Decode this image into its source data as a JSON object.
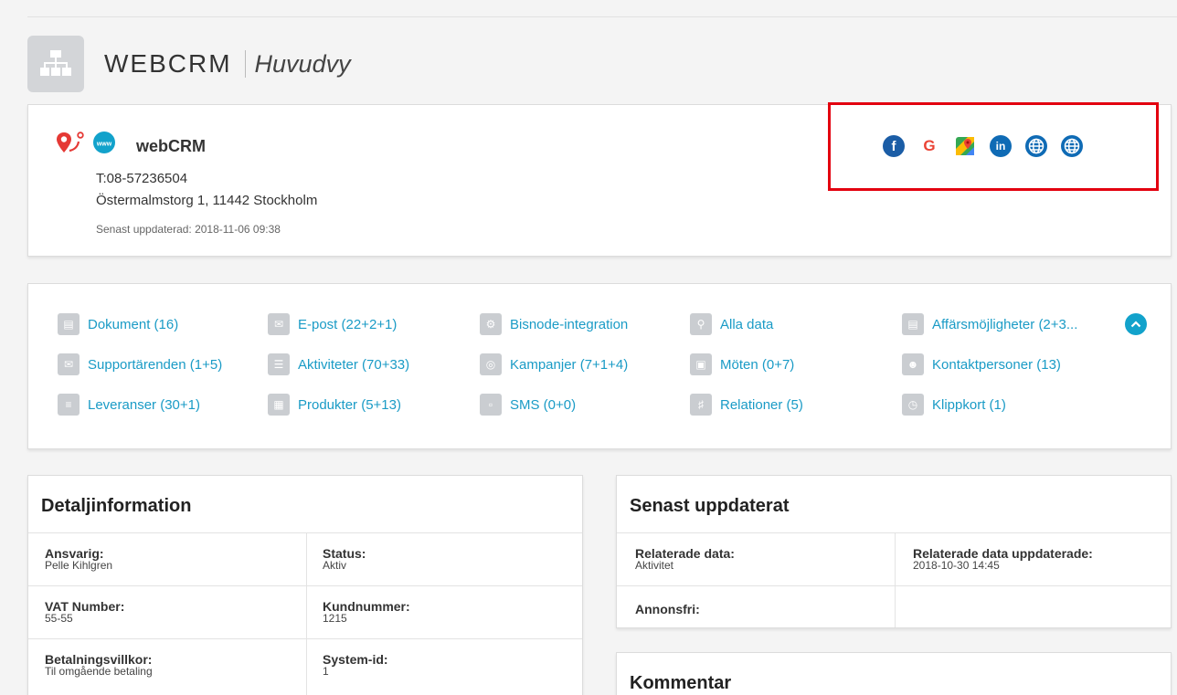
{
  "header": {
    "title": "WEBCRM",
    "subtitle": "Huvudvy"
  },
  "company": {
    "name": "webCRM",
    "phone": "T:08-57236504",
    "address": "Östermalmstorg 1, 11442 Stockholm",
    "updated": "Senast uppdaterad: 2018-11-06 09:38",
    "social": [
      {
        "name": "facebook-icon",
        "glyph": "f",
        "color": "#1b5da6"
      },
      {
        "name": "google-icon",
        "glyph": "G",
        "color": "#ea4335"
      },
      {
        "name": "google-maps-icon",
        "glyph": "",
        "color": "#34a853"
      },
      {
        "name": "linkedin-icon",
        "glyph": "in",
        "color": "#0f6bb5"
      },
      {
        "name": "website-globe-icon",
        "glyph": "",
        "color": "#0f6bb5"
      },
      {
        "name": "website-globe-icon-2",
        "glyph": "",
        "color": "#0f6bb5"
      }
    ]
  },
  "links": {
    "col1": [
      "Dokument (16)",
      "Supportärenden (1+5)",
      "Leveranser (30+1)"
    ],
    "col2": [
      "E-post (22+2+1)",
      "Aktiviteter (70+33)",
      "Produkter (5+13)"
    ],
    "col3": [
      "Bisnode-integration",
      "Kampanjer (7+1+4)",
      "SMS (0+0)"
    ],
    "col4": [
      "Alla data",
      "Möten (0+7)",
      "Relationer (5)"
    ],
    "col5": [
      "Affärsmöjligheter (2+3...",
      "Kontaktpersoner (13)",
      "Klippkort (1)"
    ]
  },
  "detail": {
    "title": "Detaljinformation",
    "fields": [
      {
        "label": "Ansvarig:",
        "value": "Pelle Kihlgren"
      },
      {
        "label": "Status:",
        "value": "Aktiv"
      },
      {
        "label": "VAT Number:",
        "value": "55-55"
      },
      {
        "label": "Kundnummer:",
        "value": "1215"
      },
      {
        "label": "Betalningsvillkor:",
        "value": "Til omgående betaling"
      },
      {
        "label": "System-id:",
        "value": "1"
      }
    ]
  },
  "recent": {
    "title": "Senast uppdaterat",
    "fields": [
      {
        "label": "Relaterade data:",
        "value": "Aktivitet"
      },
      {
        "label": "Relaterade data uppdaterade:",
        "value": "2018-10-30 14:45"
      },
      {
        "label": "Annonsfri:",
        "value": ""
      }
    ]
  },
  "comment": {
    "title": "Kommentar"
  }
}
